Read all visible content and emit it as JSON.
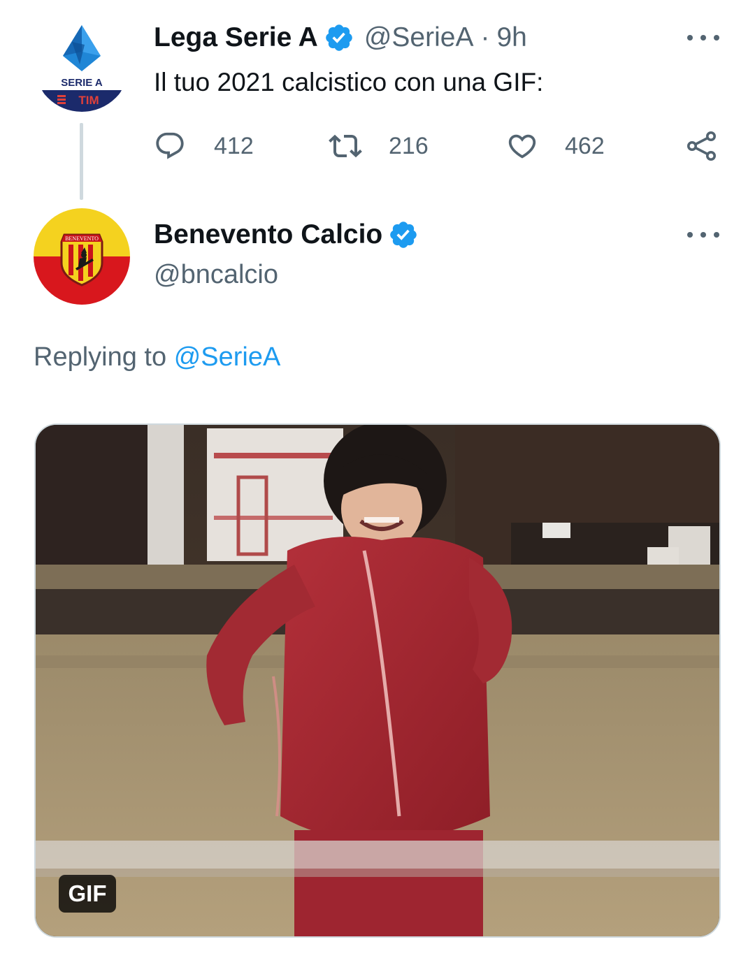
{
  "parent_tweet": {
    "display_name": "Lega Serie A",
    "handle": "@SerieA",
    "separator": "·",
    "time": "9h",
    "text": "Il tuo 2021 calcistico con una GIF:",
    "avatar": {
      "top_text": "SERIE A",
      "bottom_text": "TIM",
      "icon": "serie-a-logo-icon"
    },
    "stats": {
      "replies": "412",
      "retweets": "216",
      "likes": "462"
    }
  },
  "reply_tweet": {
    "display_name": "Benevento Calcio",
    "handle": "@bncalcio",
    "avatar": {
      "crest_text": "BENEVENTO",
      "icon": "benevento-crest-icon"
    },
    "replying_label": "Replying to",
    "replying_handle": "@SerieA",
    "media": {
      "type": "gif",
      "badge": "GIF"
    }
  },
  "colors": {
    "text_primary": "#0f1419",
    "text_secondary": "#536471",
    "link": "#1d9bf0",
    "verified": "#1d9bf0",
    "border": "#cfd9de"
  },
  "icons": [
    "more-icon",
    "reply-icon",
    "retweet-icon",
    "like-icon",
    "share-icon",
    "verified-badge-icon"
  ]
}
